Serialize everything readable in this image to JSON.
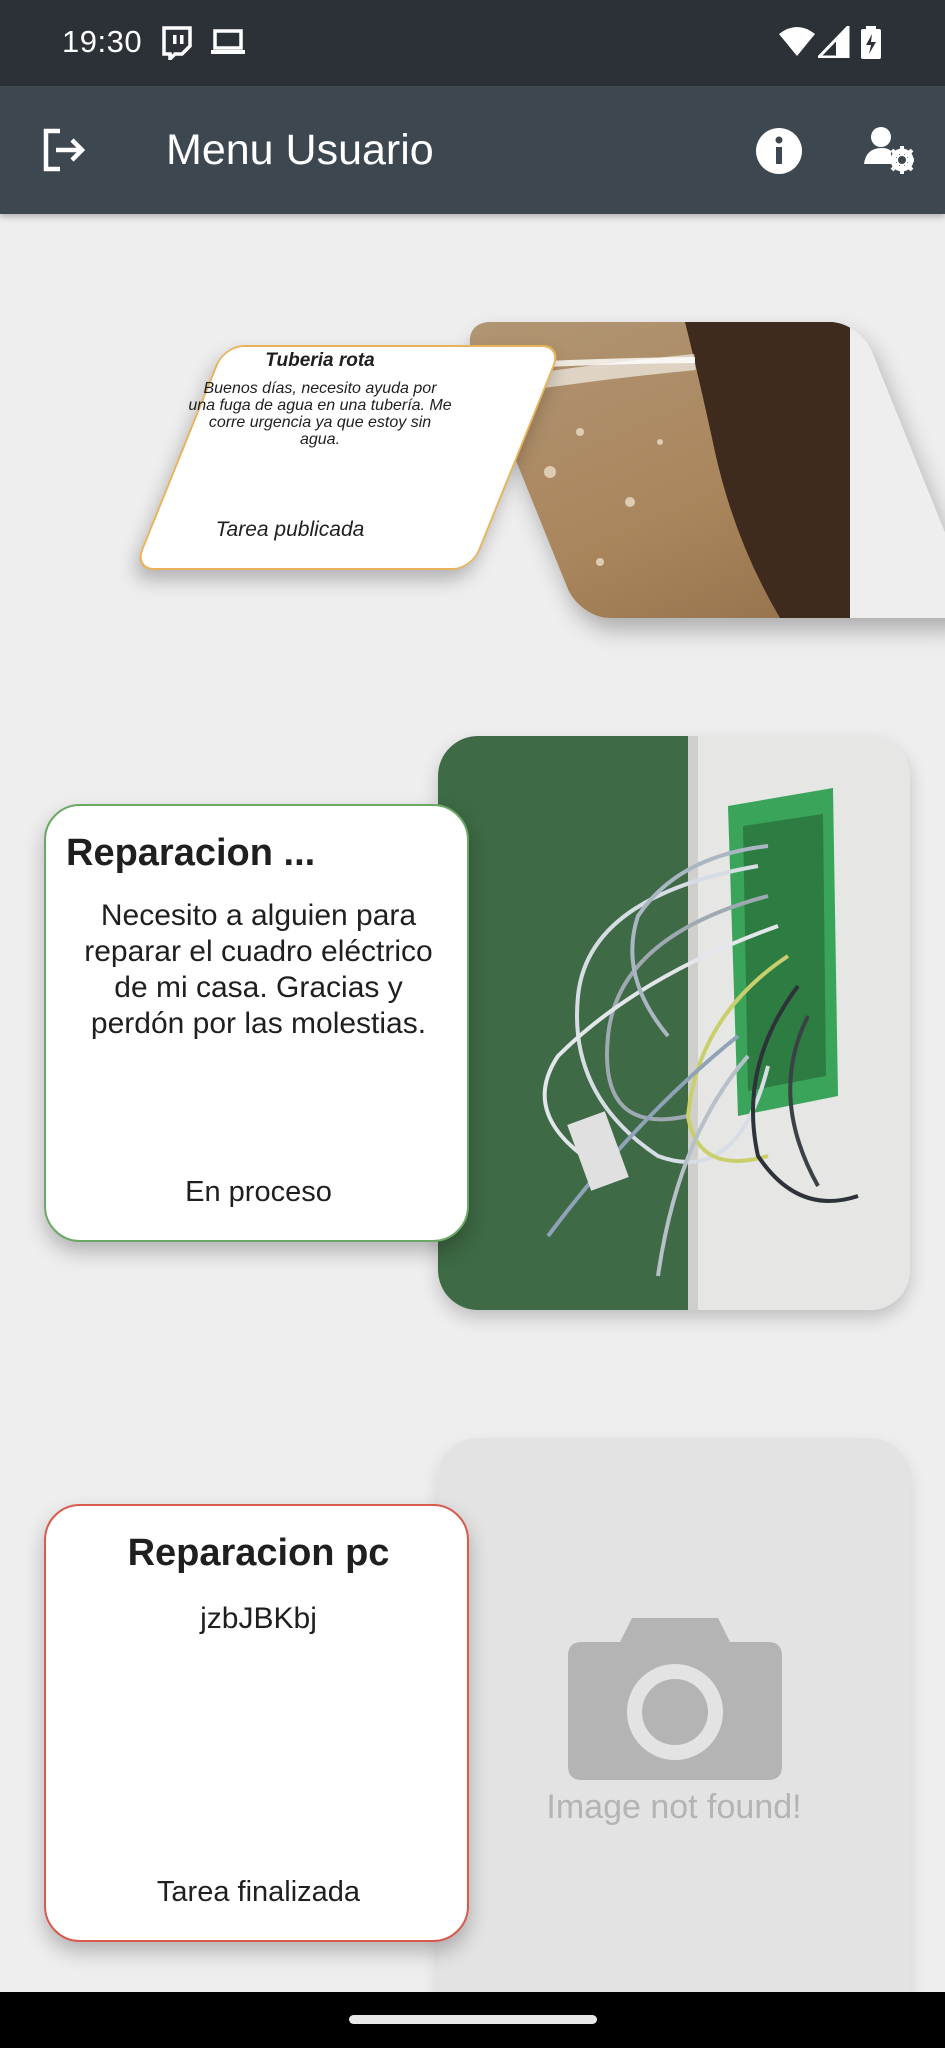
{
  "status_bar": {
    "time": "19:30"
  },
  "app_bar": {
    "title": "Menu Usuario"
  },
  "tasks": [
    {
      "title": "Tuberia rota",
      "description": "Buenos días, necesito ayuda por una fuga de agua en una tubería. Me corre urgencia ya que estoy sin agua.",
      "status": "Tarea publicada",
      "border_color": "#e8b35a"
    },
    {
      "title": "Reparacion ...",
      "description": "Necesito a alguien para reparar el cuadro eléctrico de mi casa. Gracias y perdón por las molestias.",
      "status": "En proceso",
      "border_color": "#6aa865"
    },
    {
      "title": "Reparacion pc",
      "description": "jzbJBKbj",
      "status": "Tarea finalizada",
      "border_color": "#d9594c",
      "image_placeholder": "Image not found!"
    }
  ]
}
